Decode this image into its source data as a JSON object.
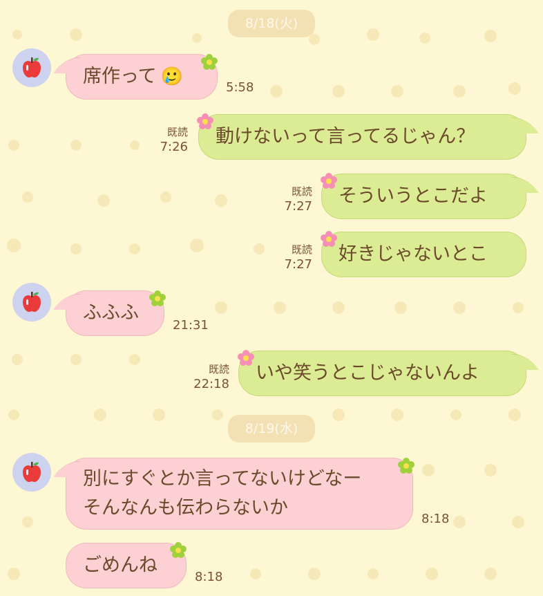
{
  "dates": [
    "8/18(火)",
    "8/19(水)"
  ],
  "read_label": "既読",
  "messages": [
    {
      "text": "席作って",
      "emoji": "🥲",
      "time": "5:58"
    },
    {
      "text": "動けないって言ってるじゃん？",
      "time": "7:26"
    },
    {
      "text": "そういうとこだよ",
      "time": "7:27"
    },
    {
      "text": "好きじゃないとこ",
      "time": "7:27"
    },
    {
      "text": "ふふふ",
      "time": "21:31"
    },
    {
      "text": "いや笑うとこじゃないんよ",
      "time": "22:18"
    },
    {
      "line1": "別にすぐとか言ってないけどなー",
      "line2": "そんなんも伝わらないか",
      "time": "8:18"
    },
    {
      "text": "ごめんね",
      "time": "8:18"
    }
  ],
  "colors": {
    "background": "#fdf7d4",
    "incoming_bubble": "#fdd0d3",
    "outgoing_bubble": "#dcec95",
    "text": "#6b4a2b",
    "date_pill": "#f2dfb0"
  },
  "icons": {
    "avatar": "apple-icon",
    "bubble_deco_in": "green-flower-icon",
    "bubble_deco_out": "pink-flower-icon"
  }
}
